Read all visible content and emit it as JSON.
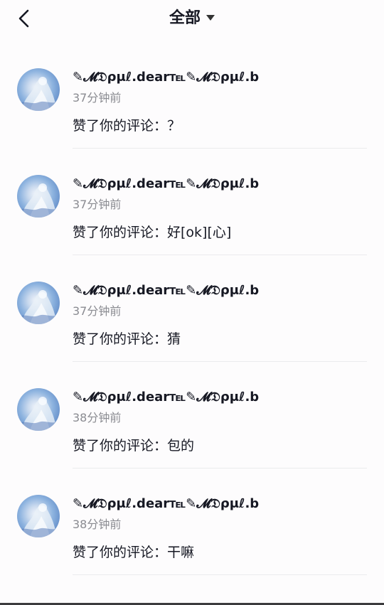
{
  "header": {
    "title": "全部",
    "back_icon": "chevron-left-icon",
    "dropdown_icon": "caret-down-icon"
  },
  "notifications": [
    {
      "username": "✎𝓜𝔇ρμℓ.dear℡✎𝓜𝔇ρμℓ.b",
      "time": "37分钟前",
      "text": "赞了你的评论：？"
    },
    {
      "username": "✎𝓜𝔇ρμℓ.dear℡✎𝓜𝔇ρμℓ.b",
      "time": "37分钟前",
      "text": "赞了你的评论：好[ok][心]"
    },
    {
      "username": "✎𝓜𝔇ρμℓ.dear℡✎𝓜𝔇ρμℓ.b",
      "time": "37分钟前",
      "text": "赞了你的评论：猜"
    },
    {
      "username": "✎𝓜𝔇ρμℓ.dear℡✎𝓜𝔇ρμℓ.b",
      "time": "38分钟前",
      "text": "赞了你的评论：包的"
    },
    {
      "username": "✎𝓜𝔇ρμℓ.dear℡✎𝓜𝔇ρμℓ.b",
      "time": "38分钟前",
      "text": "赞了你的评论：干嘛"
    }
  ]
}
